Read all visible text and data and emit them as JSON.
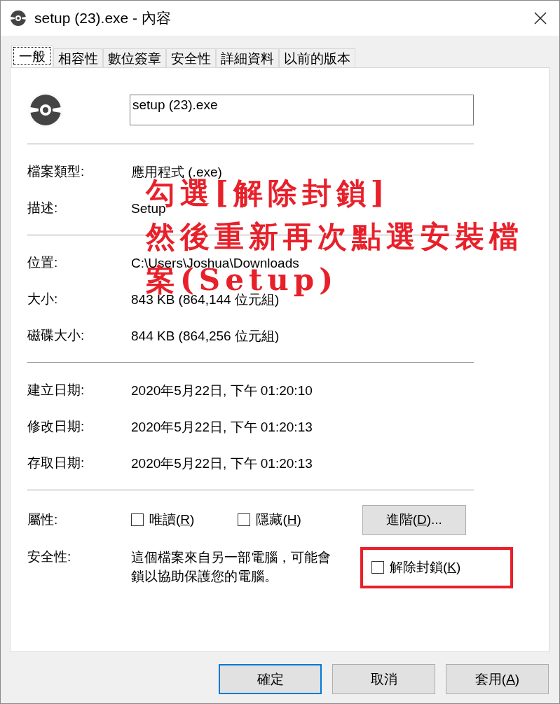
{
  "window": {
    "title": "setup (23).exe - 內容"
  },
  "tabs": [
    {
      "label": "一般",
      "selected": true
    },
    {
      "label": "相容性",
      "selected": false
    },
    {
      "label": "數位簽章",
      "selected": false
    },
    {
      "label": "安全性",
      "selected": false
    },
    {
      "label": "詳細資料",
      "selected": false
    },
    {
      "label": "以前的版本",
      "selected": false
    }
  ],
  "file_name": {
    "value": "setup (23).exe"
  },
  "groups": [
    {
      "rows": [
        {
          "label": "檔案類型:",
          "value": "應用程式 (.exe)"
        },
        {
          "label": "描述:",
          "value": "Setup"
        }
      ]
    },
    {
      "rows": [
        {
          "label": "位置:",
          "value": "C:\\Users\\Joshua\\Downloads"
        },
        {
          "label": "大小:",
          "value": "843 KB (864,144 位元組)"
        },
        {
          "label": "磁碟大小:",
          "value": "844 KB (864,256 位元組)"
        }
      ]
    },
    {
      "rows": [
        {
          "label": "建立日期:",
          "value": "2020年5月22日, 下午 01:20:10"
        },
        {
          "label": "修改日期:",
          "value": "2020年5月22日, 下午 01:20:13"
        },
        {
          "label": "存取日期:",
          "value": "2020年5月22日, 下午 01:20:13"
        }
      ]
    }
  ],
  "attributes": {
    "label": "屬性:",
    "checkboxes": [
      {
        "parts": [
          "唯讀(",
          "R",
          ")"
        ],
        "checked": false
      },
      {
        "parts": [
          "隱藏(",
          "H",
          ")"
        ],
        "checked": false
      }
    ],
    "advanced_button": {
      "parts": [
        "進階(",
        "D",
        ")..."
      ]
    }
  },
  "security": {
    "label": "安全性:",
    "text_lines": [
      "這個檔案來自另一部電腦，可能會",
      "鎖以協助保護您的電腦。"
    ],
    "unblock": {
      "parts": [
        "解除封鎖(",
        "K",
        ")"
      ],
      "checked": false,
      "highlighted": true
    }
  },
  "annotation": {
    "lines": [
      "勾選[解除封鎖]",
      "然後重新再次點選安裝檔",
      "案(Setup)"
    ]
  },
  "buttons": [
    {
      "parts": [
        "確定"
      ],
      "default": true
    },
    {
      "parts": [
        "取消"
      ],
      "default": false
    },
    {
      "parts": [
        "套用(",
        "A",
        ")"
      ],
      "default": false
    }
  ]
}
